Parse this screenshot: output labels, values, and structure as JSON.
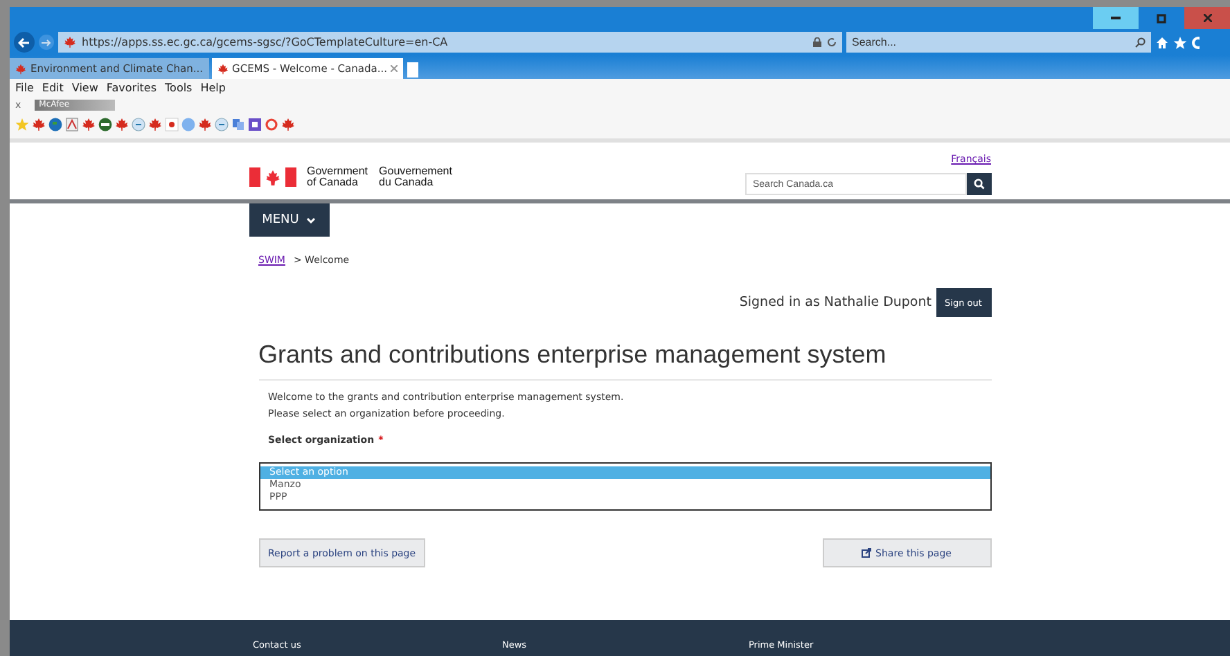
{
  "browser": {
    "address": "https://apps.ss.ec.gc.ca/gcems-sgsc/?GoCTemplateCulture=en-CA",
    "search_placeholder": "Search...",
    "tabs": [
      {
        "label": "Environment and Climate Chan...",
        "selected": false
      },
      {
        "label": "GCEMS - Welcome - Canada...",
        "selected": true
      }
    ],
    "menu": [
      "File",
      "Edit",
      "View",
      "Favorites",
      "Tools",
      "Help"
    ],
    "addon_close": "x",
    "addon_label": "McAfee"
  },
  "header": {
    "language_link": "Français",
    "wordmark_en": [
      "Government",
      "of Canada"
    ],
    "wordmark_fr": [
      "Gouvernement",
      "du Canada"
    ],
    "search_placeholder": "Search Canada.ca",
    "menu_button": "MENU"
  },
  "breadcrumb": {
    "link": "SWIM",
    "current": "> Welcome"
  },
  "signed_in": "Signed in as Nathalie Dupont",
  "sign_out": "Sign out",
  "title": "Grants and contributions enterprise management system",
  "intro": [
    "Welcome to the grants and contribution enterprise management system.",
    "Please select an organization before proceeding."
  ],
  "select": {
    "label": "Select organization",
    "required_mark": "*",
    "options": [
      {
        "label": "Select an option",
        "selected": true
      },
      {
        "label": "Manzo",
        "selected": false
      },
      {
        "label": "PPP",
        "selected": false
      }
    ]
  },
  "report_button": "Report a problem on this page",
  "share_button": "Share this page",
  "footer": [
    "Contact us",
    "News",
    "Prime Minister"
  ]
}
